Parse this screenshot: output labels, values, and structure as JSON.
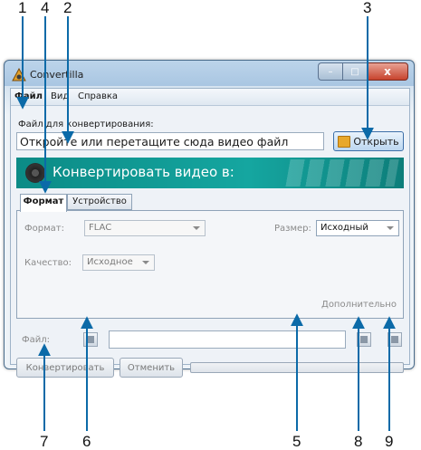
{
  "callouts": [
    "1",
    "2",
    "3",
    "4",
    "5",
    "6",
    "7",
    "8",
    "9"
  ],
  "window": {
    "title": "Convertilla",
    "controls": {
      "minimize": "–",
      "maximize": "□",
      "close": "x"
    }
  },
  "menu": {
    "file": "Файл",
    "view": "Вид",
    "help": "Справка"
  },
  "file_section": {
    "label": "Файл для конвертирования:",
    "input_value": "Откройте или перетащите сюда видео файл",
    "open_button": "Открыть"
  },
  "banner": {
    "title": "Конвертировать видео в:"
  },
  "tabs": {
    "format": "Формат",
    "device": "Устройство"
  },
  "format_panel": {
    "format_label": "Формат:",
    "format_value": "FLAC",
    "size_label": "Размер:",
    "size_value": "Исходный",
    "quality_label": "Качество:",
    "quality_value": "Исходное",
    "advanced_link": "Дополнительно"
  },
  "output": {
    "label": "Файл:",
    "path_value": ""
  },
  "actions": {
    "convert": "Конвертировать",
    "cancel": "Отменить",
    "progress": 0
  },
  "colors": {
    "banner": "#15a6a0",
    "titlebar": "#bcd4ea",
    "close": "#c7432d"
  }
}
